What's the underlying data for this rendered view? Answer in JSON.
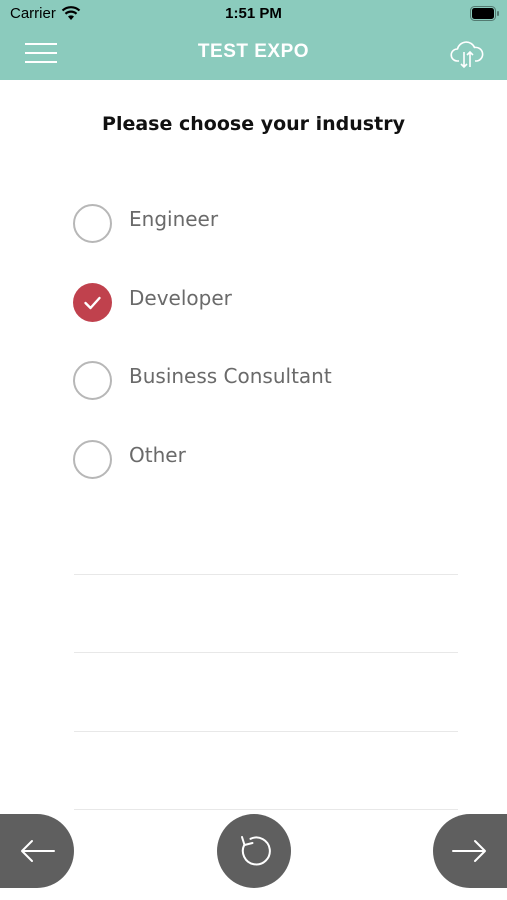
{
  "status_bar": {
    "carrier": "Carrier",
    "time": "1:51 PM"
  },
  "nav": {
    "title": "TEST EXPO",
    "menu_icon": "hamburger-menu-icon",
    "sync_icon": "cloud-upload-download-icon"
  },
  "question": "Please choose your industry",
  "options": [
    {
      "label": "Engineer",
      "checked": false
    },
    {
      "label": "Developer",
      "checked": true
    },
    {
      "label": "Business Consultant",
      "checked": false
    },
    {
      "label": "Other",
      "checked": false
    }
  ],
  "footer": {
    "back_icon": "arrow-left-icon",
    "reset_icon": "reset-icon",
    "next_icon": "arrow-right-icon"
  },
  "colors": {
    "header": "#8bcbbd",
    "checked": "#c0414d",
    "button": "#5f5f5f"
  }
}
